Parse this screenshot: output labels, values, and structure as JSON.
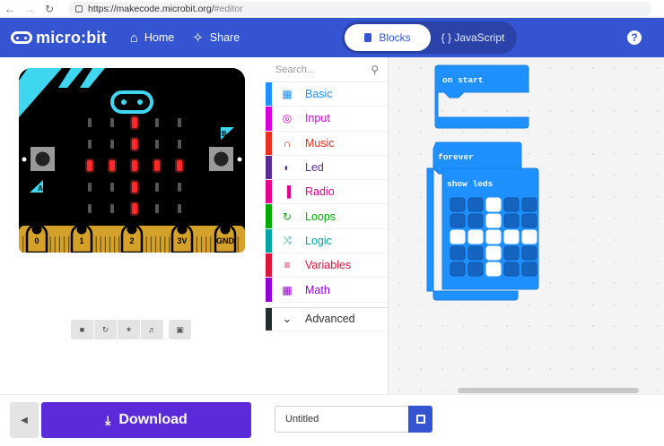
{
  "browser": {
    "url_prefix": "https://makecode.microbit.org/",
    "url_hash": "#editor"
  },
  "header": {
    "logo_text": "micro:bit",
    "home_label": "Home",
    "share_label": "Share",
    "blocks_label": "Blocks",
    "javascript_label": "{ } JavaScript",
    "help_label": "?"
  },
  "simulator": {
    "pins": [
      "0",
      "1",
      "2",
      "3V",
      "GND"
    ],
    "button_a": "A",
    "button_b": "B",
    "led_pattern": [
      [
        0,
        0,
        1,
        0,
        0
      ],
      [
        0,
        0,
        1,
        0,
        0
      ],
      [
        1,
        1,
        1,
        1,
        1
      ],
      [
        0,
        0,
        1,
        0,
        0
      ],
      [
        0,
        0,
        1,
        0,
        0
      ]
    ],
    "tools": [
      "stop-icon",
      "restart-icon",
      "slowmo-icon",
      "mute-icon",
      "fullscreen-icon"
    ]
  },
  "toolbox": {
    "search_placeholder": "Search...",
    "categories": [
      {
        "label": "Basic",
        "color": "#1e90ff",
        "icon": "grid-icon"
      },
      {
        "label": "Input",
        "color": "#d400d4",
        "icon": "target-icon"
      },
      {
        "label": "Music",
        "color": "#e63022",
        "icon": "headphones-icon"
      },
      {
        "label": "Led",
        "color": "#5c2d91",
        "icon": "toggle-icon"
      },
      {
        "label": "Radio",
        "color": "#e3008c",
        "icon": "signal-icon"
      },
      {
        "label": "Loops",
        "color": "#00aa00",
        "icon": "loop-icon"
      },
      {
        "label": "Logic",
        "color": "#00a4a6",
        "icon": "shuffle-icon"
      },
      {
        "label": "Variables",
        "color": "#dc143c",
        "icon": "lines-icon"
      },
      {
        "label": "Math",
        "color": "#9400d3",
        "icon": "calculator-icon"
      }
    ],
    "advanced_label": "Advanced",
    "advanced_color": "#232d2d"
  },
  "workspace": {
    "on_start_label": "on start",
    "forever_label": "forever",
    "show_leds_label": "show leds",
    "block_color": "#1e90ff",
    "block_border": "#1c7fe0",
    "led_grid": [
      [
        0,
        0,
        1,
        0,
        0
      ],
      [
        0,
        0,
        1,
        0,
        0
      ],
      [
        1,
        1,
        1,
        1,
        1
      ],
      [
        0,
        0,
        1,
        0,
        0
      ],
      [
        0,
        0,
        1,
        0,
        0
      ]
    ]
  },
  "footer": {
    "download_label": "Download",
    "project_name": "Untitled"
  }
}
